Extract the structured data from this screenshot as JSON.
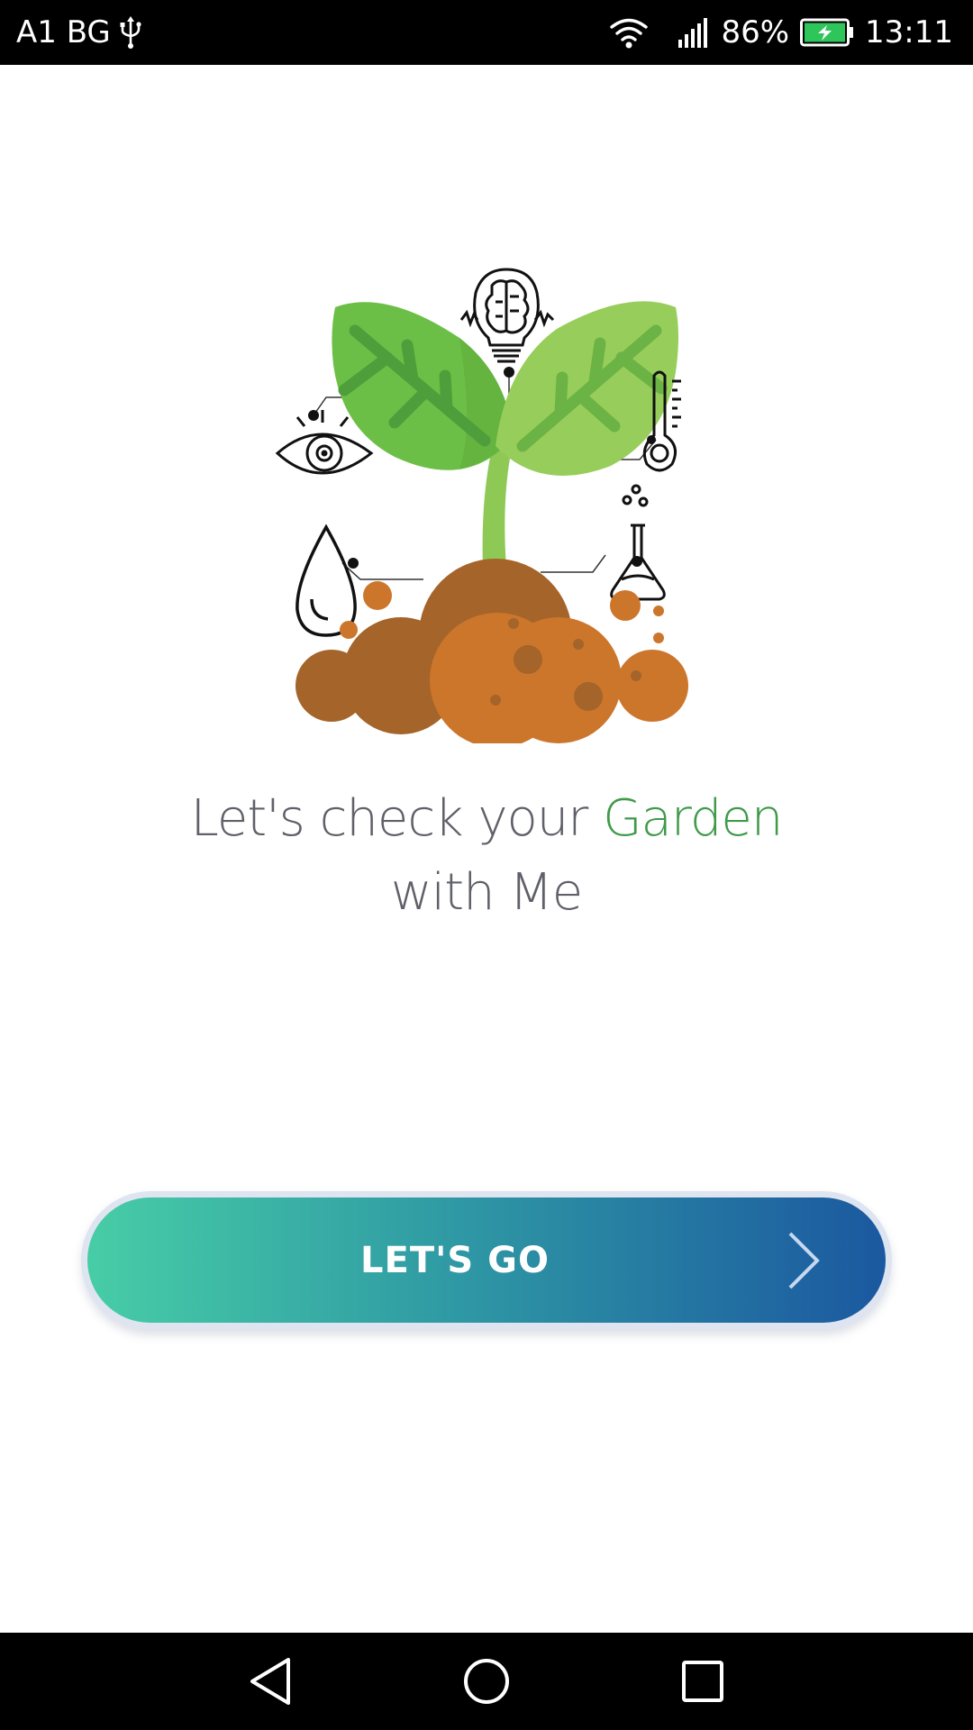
{
  "status_bar": {
    "carrier": "A1 BG",
    "usb_icon": "usb-icon",
    "wifi_icon": "wifi-icon",
    "signal_icon": "signal-icon",
    "battery_percent": "86%",
    "battery_icon": "battery-charging-icon",
    "time": "13:11"
  },
  "illustration": {
    "icons": [
      "eye-icon",
      "lightbulb-brain-icon",
      "thermometer-icon",
      "water-drop-icon",
      "flask-icon",
      "plant-icon",
      "soil-icon"
    ],
    "colors": {
      "leaf_dark": "#6cbf46",
      "leaf_light": "#97cd5b",
      "vein": "#4f9e3c",
      "soil_dark": "#a4642a",
      "soil_light": "#cc762c"
    }
  },
  "headline": {
    "part1": "Let's check your ",
    "accent": "Garden",
    "part2": "with Me",
    "accent_color": "#3f9a4a"
  },
  "cta": {
    "label": "LET'S GO",
    "icon": "chevron-right-icon",
    "gradient_start": "#47cda6",
    "gradient_end": "#1b58a0"
  },
  "nav_bar": {
    "back_icon": "back-triangle-icon",
    "home_icon": "home-circle-icon",
    "recents_icon": "recents-square-icon"
  }
}
